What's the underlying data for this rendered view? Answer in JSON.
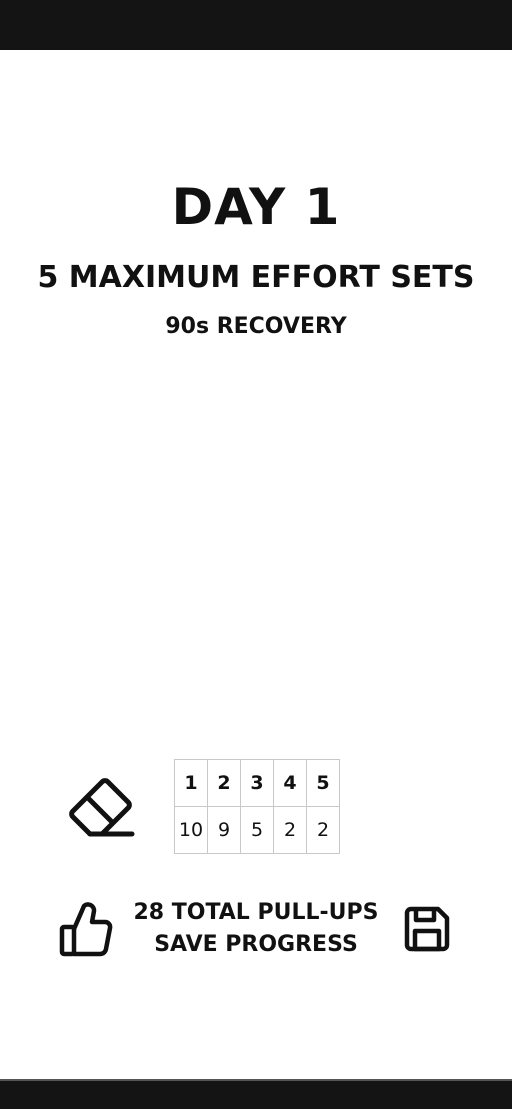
{
  "workout": {
    "title": "DAY 1",
    "subtitle": "5 MAXIMUM EFFORT SETS",
    "recovery": "90s RECOVERY"
  },
  "sets": {
    "headers": [
      "1",
      "2",
      "3",
      "4",
      "5"
    ],
    "reps": [
      "10",
      "9",
      "5",
      "2",
      "2"
    ]
  },
  "summary": {
    "total": "28 TOTAL PULL-UPS",
    "save_label": "SAVE PROGRESS"
  },
  "icons": {
    "clear": "eraser-icon",
    "like": "thumbs-up-icon",
    "save": "floppy-disk-icon"
  },
  "colors": {
    "background": "#ffffff",
    "text": "#111111",
    "system_bars": "#141414",
    "grid": "#c8c8c8"
  }
}
